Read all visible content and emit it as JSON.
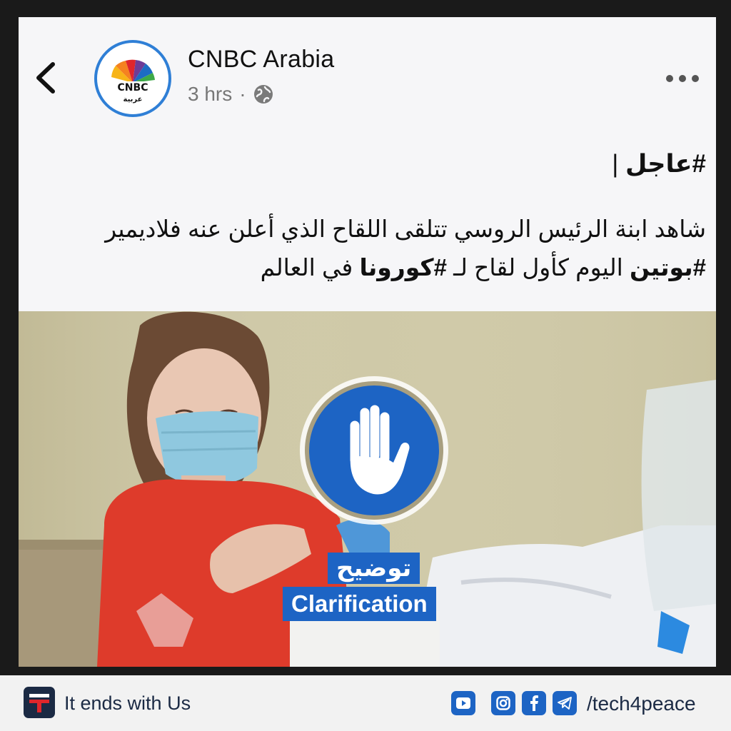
{
  "post": {
    "page_name": "CNBC Arabia",
    "time": "3 hrs",
    "separator": "·",
    "avatar_logo_text": "CNBC",
    "avatar_logo_subtext": "عربية",
    "breaking_tag": "#عاجل",
    "breaking_sep": " |",
    "line1": "شاهد ابنة الرئيس الروسي تتلقى اللقاح الذي أعلن عنه فلاديمير",
    "line2_tag1": "#بوتين",
    "line2_mid": " اليوم كأول لقاح لـ ",
    "line2_tag2": "#كورونا",
    "line2_end": " في العالم"
  },
  "media": {
    "label_arabic": "توضيح",
    "label_english": "Clarification"
  },
  "footer": {
    "brand": "It ends with Us",
    "handle": "/tech4peace",
    "icons": [
      "youtube-icon",
      "instagram-icon",
      "facebook-icon",
      "telegram-icon"
    ]
  },
  "colors": {
    "accent": "#1d64c4",
    "background": "#f6f6f8",
    "frame": "#1a1a1a"
  }
}
